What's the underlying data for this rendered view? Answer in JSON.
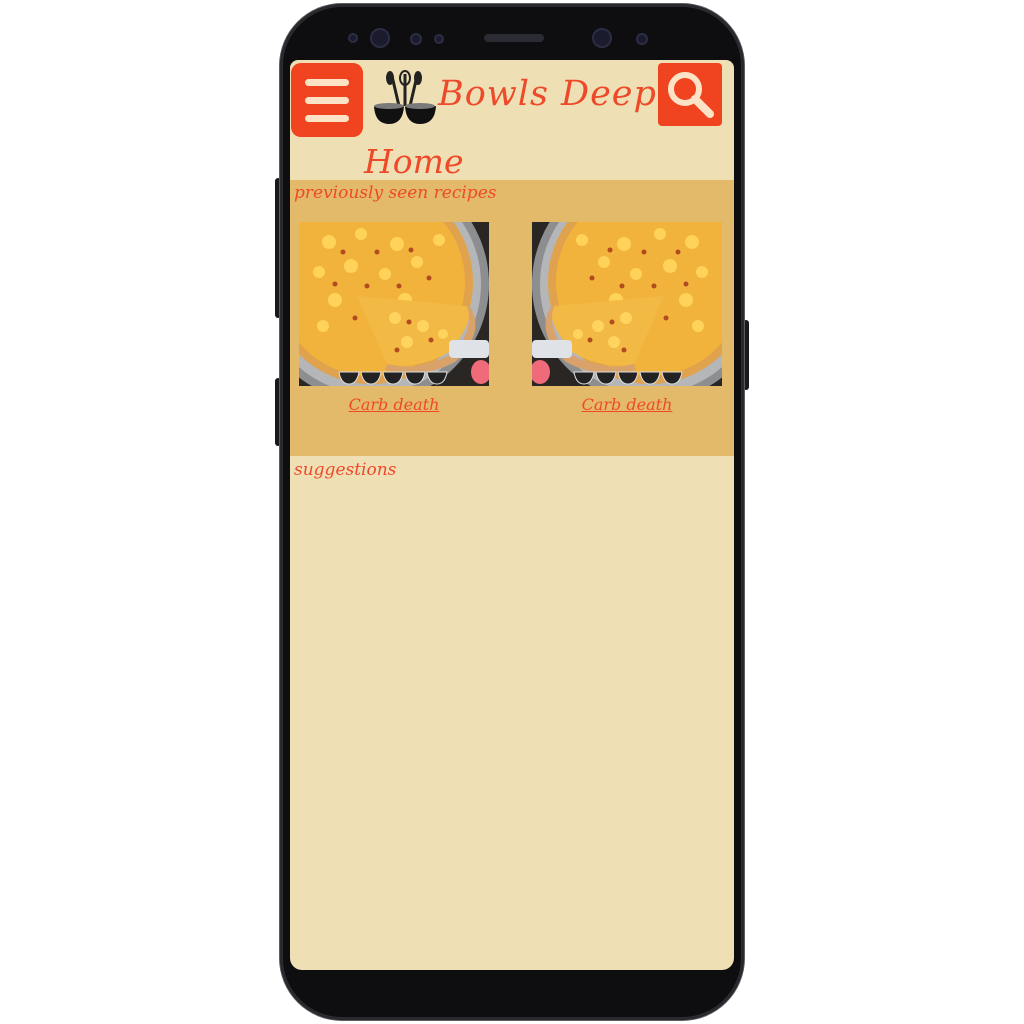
{
  "app": {
    "brand_name": "Bowls Deep",
    "page_title": "Home",
    "accent_color": "#f04420",
    "background_color": "#efdfb5",
    "section_color": "#e3ba6a"
  },
  "header": {
    "menu_icon": "hamburger-menu-icon",
    "search_icon": "magnifier-search-icon",
    "logo_icon": "bowls-utensils-logo-icon"
  },
  "sections": {
    "recent_label": "previously seen recipes",
    "suggestions_label": "suggestions"
  },
  "recent_recipes": [
    {
      "title": "Carb death",
      "image": "mac-and-cheese-pizza-photo"
    },
    {
      "title": "Carb death",
      "image": "mac-and-cheese-pizza-photo-mirrored"
    }
  ]
}
